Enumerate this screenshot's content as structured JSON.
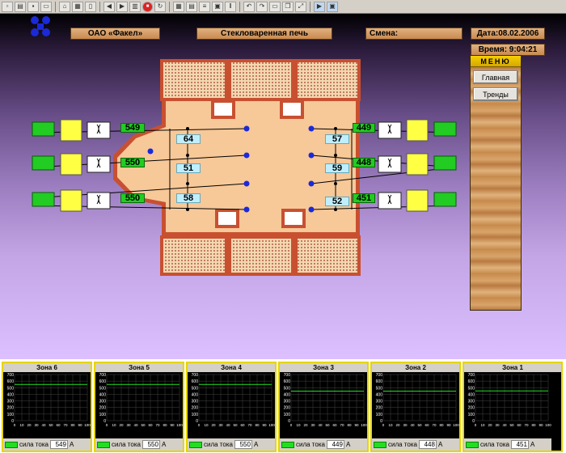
{
  "header": {
    "company": "ОАО «Факел»",
    "title": "Стекловаренная печь",
    "shift_label": "Смена:",
    "date": "Дата:08.02.2006",
    "time": "Время: 9:04:21"
  },
  "menu": {
    "title": "МЕНЮ",
    "items": [
      "Главная",
      "Тренды"
    ]
  },
  "left_currents": [
    "549",
    "550",
    "550"
  ],
  "right_currents": [
    "449",
    "448",
    "451"
  ],
  "left_inner": [
    "64",
    "51",
    "58"
  ],
  "right_inner": [
    "57",
    "59",
    "52"
  ],
  "zones": [
    {
      "title": "Зона 6",
      "label": "сила тока",
      "value": "549",
      "unit": "А",
      "level": 549
    },
    {
      "title": "Зона 5",
      "label": "сила тока",
      "value": "550",
      "unit": "А",
      "level": 550
    },
    {
      "title": "Зона 4",
      "label": "сила тока",
      "value": "550",
      "unit": "А",
      "level": 550
    },
    {
      "title": "Зона 3",
      "label": "сила тока",
      "value": "449",
      "unit": "А",
      "level": 449
    },
    {
      "title": "Зона 2",
      "label": "сила тока",
      "value": "448",
      "unit": "А",
      "level": 448
    },
    {
      "title": "Зона 1",
      "label": "сила тока",
      "value": "451",
      "unit": "А",
      "level": 451
    }
  ],
  "trend_axis": {
    "y_ticks": [
      "700",
      "600",
      "500",
      "400",
      "300",
      "200",
      "100",
      "0"
    ],
    "x_ticks": [
      "0",
      "10",
      "20",
      "30",
      "40",
      "50",
      "60",
      "70",
      "80",
      "90",
      "100"
    ],
    "ymax": 700
  },
  "colors": {
    "trend_line": "#22dd22",
    "panel_border": "#e6d400"
  }
}
